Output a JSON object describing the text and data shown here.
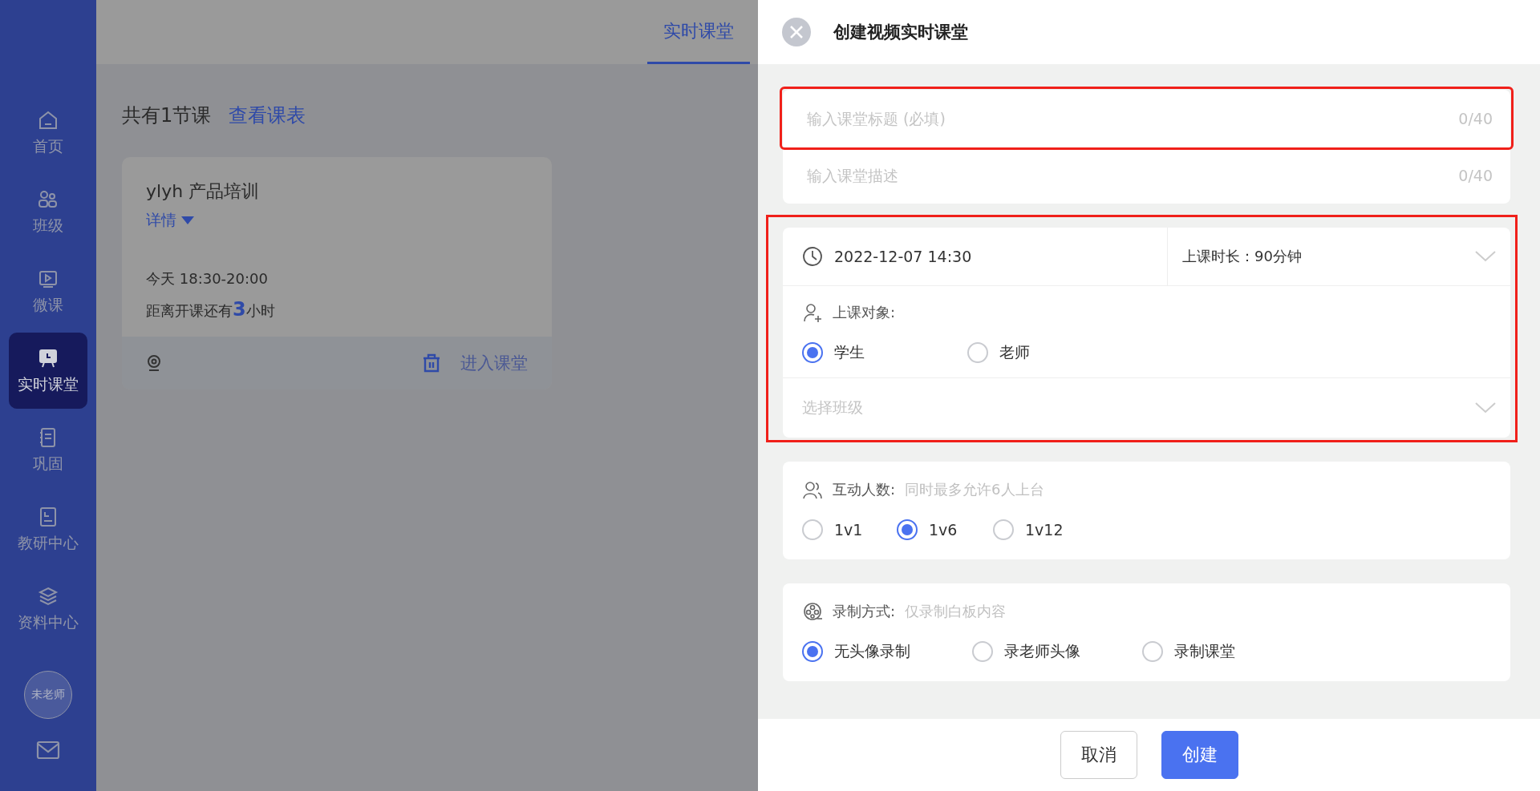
{
  "sidebar": {
    "items": [
      {
        "label": "首页",
        "selected": false
      },
      {
        "label": "班级",
        "selected": false
      },
      {
        "label": "微课",
        "selected": false
      },
      {
        "label": "实时课堂",
        "selected": true
      },
      {
        "label": "巩固",
        "selected": false
      },
      {
        "label": "教研中心",
        "selected": false
      },
      {
        "label": "资料中心",
        "selected": false
      }
    ],
    "avatar": "未老师"
  },
  "header": {
    "tabs": [
      {
        "label": "实时课堂",
        "selected": true
      }
    ]
  },
  "main": {
    "count": "共有1节课",
    "schedule_link": "查看课表",
    "courses": [
      {
        "title": "ylyh 产品培训",
        "details": "详情",
        "time": "今天 18:30-20:00",
        "countdown": "距离开课还有**3**小时",
        "enter": "进入课堂"
      }
    ]
  },
  "dialog": {
    "title": "创建视频实时课堂",
    "sections": [
      {
        "kind": "text_fields",
        "fields": [
          {
            "placeholder": "输入课堂标题 (必填)",
            "counter": "0/40",
            "highlighted": true
          },
          {
            "placeholder": "输入课堂描述",
            "counter": "0/40",
            "highlighted": false
          }
        ]
      },
      {
        "kind": "schedule",
        "highlighted": true,
        "datetime": "2022-12-07 14:30",
        "duration": "上课时长：90分钟",
        "audience_label": "上课对象:",
        "audience": [
          {
            "label": "学生",
            "selected": true
          },
          {
            "label": "老师",
            "selected": false
          }
        ],
        "class_placeholder": "选择班级"
      },
      {
        "kind": "options",
        "label": "互动人数:",
        "hint": "同时最多允许6人上台",
        "options": [
          {
            "label": "1v1",
            "selected": false
          },
          {
            "label": "1v6",
            "selected": true
          },
          {
            "label": "1v12",
            "selected": false
          }
        ]
      },
      {
        "kind": "options",
        "label": "录制方式:",
        "hint": "仅录制白板内容",
        "options": [
          {
            "label": "无头像录制",
            "selected": true
          },
          {
            "label": "录老师头像",
            "selected": false
          },
          {
            "label": "录制课堂",
            "selected": false
          }
        ]
      }
    ],
    "buttons": [
      {
        "label": "取消",
        "kind": "secondary"
      },
      {
        "label": "创建",
        "kind": "primary"
      }
    ]
  }
}
